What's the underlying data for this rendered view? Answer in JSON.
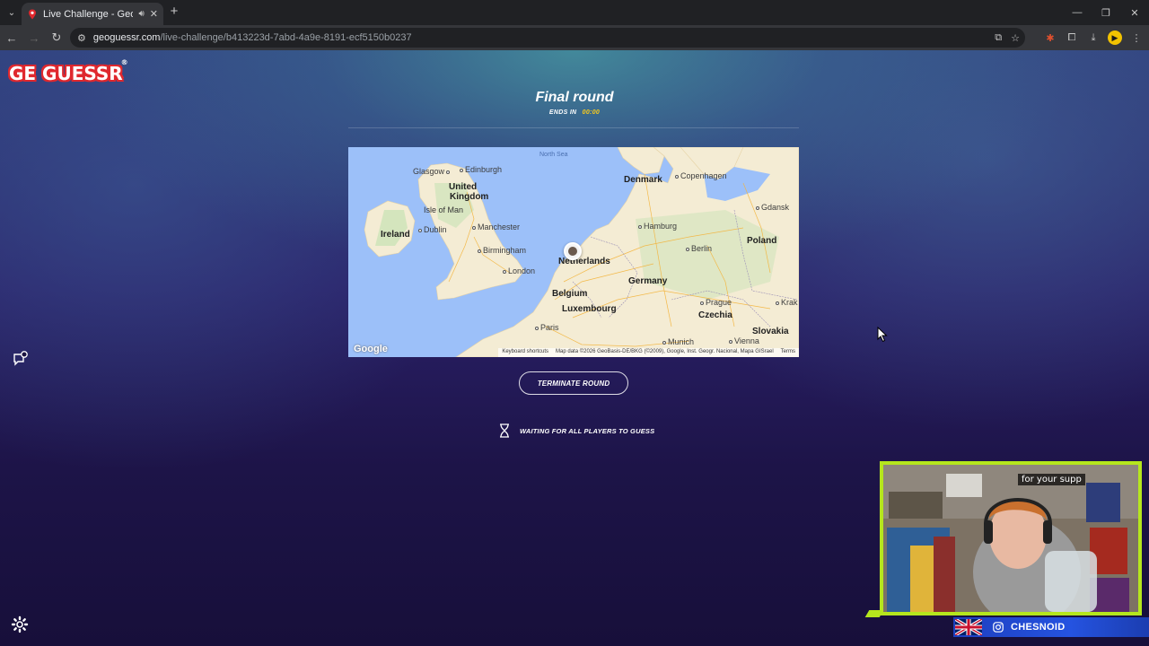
{
  "browser": {
    "tab_title": "Live Challenge - GeoGuessr",
    "url_host": "geoguessr.com",
    "url_path": "/live-challenge/b413223d-7abd-4a9e-8191-ecf5150b0237"
  },
  "app": {
    "logo_text": "GE GUESSR",
    "logo_reg": "®"
  },
  "round": {
    "title": "Final round",
    "ends_label": "ENDS IN",
    "ends_time": "00:00"
  },
  "map": {
    "sea_label": "North Sea",
    "countries": [
      "United Kingdom",
      "Ireland",
      "Denmark",
      "Netherlands",
      "Germany",
      "Belgium",
      "Luxembourg",
      "Poland",
      "Czechia",
      "Slovakia",
      "Isle of Man"
    ],
    "cities": [
      "Glasgow",
      "Edinburgh",
      "Copenhagen",
      "Gdansk",
      "Dublin",
      "Manchester",
      "Hamburg",
      "Birmingham",
      "Berlin",
      "London",
      "Paris",
      "Prague",
      "Munich",
      "Vienna",
      "Krak"
    ],
    "google_logo": "Google",
    "footer": {
      "shortcuts": "Keyboard shortcuts",
      "data": "Map data ©2026 GeoBasis-DE/BKG (©2009), Google, Inst. Geogr. Nacional, Mapa GISrael",
      "terms": "Terms"
    }
  },
  "actions": {
    "terminate_label": "TERMINATE ROUND",
    "waiting_label": "WAITING FOR ALL PLAYERS TO GUESS"
  },
  "webcam": {
    "caption": "for your supp",
    "streamer_name": "CHESNOID"
  },
  "colors": {
    "accent_yellow": "#fecd19",
    "logo_red": "#e0282e",
    "webcam_border": "#b5e61d",
    "name_bar": "#2553e0"
  }
}
